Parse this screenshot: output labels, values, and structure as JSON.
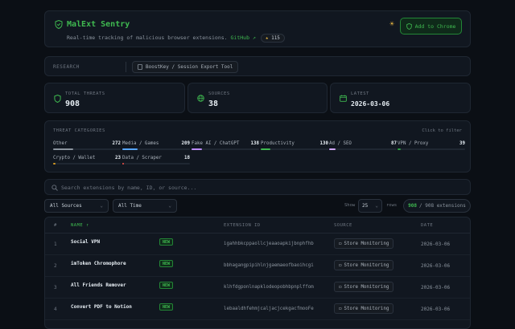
{
  "header": {
    "title": "MalExt Sentry",
    "subtitle": "Real-time tracking of malicious browser extensions.",
    "github_link": "GitHub ↗",
    "stars": "115",
    "theme_icon": "sun-icon",
    "add_button": "Add to Chrome"
  },
  "research": {
    "label": "RESEARCH",
    "chip": "BoostKey / Session Export Tool"
  },
  "stats": [
    {
      "label": "TOTAL THREATS",
      "value": "908",
      "icon": "shield-icon"
    },
    {
      "label": "SOURCES",
      "value": "38",
      "icon": "globe-icon"
    },
    {
      "label": "LATEST",
      "value": "2026-03-06",
      "icon": "calendar-icon"
    }
  ],
  "categories": {
    "label": "THREAT CATEGORIES",
    "hint": "Click to filter",
    "items": [
      {
        "name": "Other",
        "count": "272",
        "fraction": 0.3,
        "color": "#8b949e"
      },
      {
        "name": "Media / Games",
        "count": "209",
        "fraction": 0.23,
        "color": "#58a6ff"
      },
      {
        "name": "Fake AI / ChatGPT",
        "count": "138",
        "fraction": 0.15,
        "color": "#bc8cff"
      },
      {
        "name": "Productivity",
        "count": "130",
        "fraction": 0.14,
        "color": "#3fb950"
      },
      {
        "name": "Ad / SEO",
        "count": "87",
        "fraction": 0.1,
        "color": "#d2a8ff"
      },
      {
        "name": "VPN / Proxy",
        "count": "39",
        "fraction": 0.05,
        "color": "#2ea043"
      },
      {
        "name": "Crypto / Wallet",
        "count": "23",
        "fraction": 0.03,
        "color": "#d29922"
      },
      {
        "name": "Data / Scraper",
        "count": "18",
        "fraction": 0.02,
        "color": "#f85149"
      }
    ]
  },
  "search": {
    "placeholder": "Search extensions by name, ID, or source..."
  },
  "filters": {
    "source": "All Sources",
    "time": "All Time",
    "show_label": "Show",
    "rows": "25",
    "rows_label": "rows",
    "count_shown": "908",
    "count_text": "/ 908 extensions"
  },
  "table": {
    "headers": {
      "num": "#",
      "name": "NAME ↑",
      "id": "EXTENSION ID",
      "source": "SOURCE",
      "date": "DATE"
    },
    "rows": [
      {
        "num": "1",
        "name": "Social VPN",
        "badge": "NEW",
        "id": "igahhbkcppaollcjeaaoapkijbnphfhb",
        "source": "Store Monitoring",
        "date": "2026-03-06"
      },
      {
        "num": "2",
        "name": "imToken Chromophore",
        "badge": "NEW",
        "id": "bbhagangpipihlnjgaemaeofbaoihcgi",
        "source": "Store Monitoring",
        "date": "2026-03-06"
      },
      {
        "num": "3",
        "name": "All Friends Remover",
        "badge": "NEW",
        "id": "klhfdgponlnapklodeopobhbpnplffom",
        "source": "Store Monitoring",
        "date": "2026-03-06"
      },
      {
        "num": "4",
        "name": "Convert PDF to Notion",
        "badge": "NEW",
        "id": "lebaaldhfehmjcaljacjcekgacfmooFe",
        "source": "Store Monitoring",
        "date": "2026-03-06"
      }
    ]
  }
}
